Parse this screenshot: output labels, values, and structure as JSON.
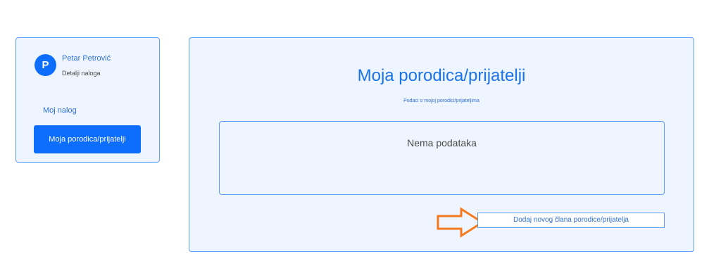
{
  "sidebar": {
    "avatar_initial": "P",
    "user_name": "Petar Petrović",
    "user_subtitle": "Detalji naloga",
    "nav_items": [
      {
        "label": "Moj nalog"
      },
      {
        "label": "Moja porodica/prijatelji",
        "active": true
      }
    ]
  },
  "main": {
    "title": "Moja porodica/prijatelji",
    "subtitle": "Podaci o mojoj porodici/prijateljima",
    "empty_message": "Nema podataka",
    "add_button_label": "Dodaj novog člana porodice/prijatelja"
  },
  "colors": {
    "accent": "#0d6efd",
    "panel_background": "#eef5ff",
    "panel_border": "#5b9bf2",
    "arrow": "#f47b20"
  },
  "icons": {
    "annotation": "right-arrow-icon"
  }
}
